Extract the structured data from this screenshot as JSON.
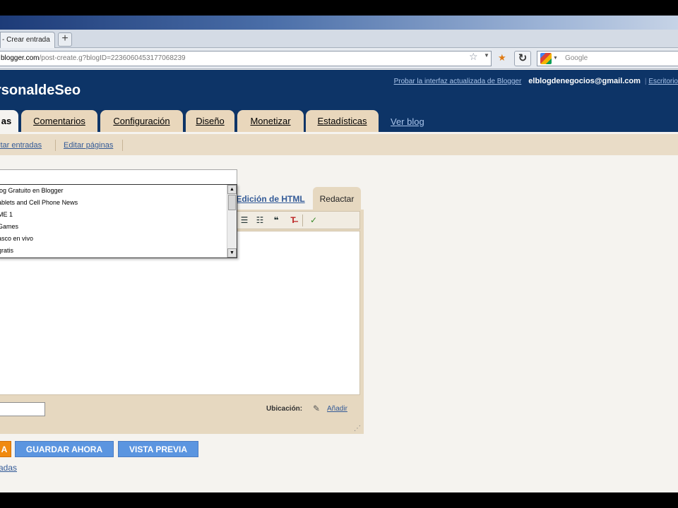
{
  "browser": {
    "tab_title": "- Crear entrada",
    "new_tab": "+",
    "url_domain": "blogger.com",
    "url_path": "/post-create.g?blogID=2236060453177068239",
    "search_placeholder": "Google"
  },
  "header": {
    "blog_name": "rsonaldeSeo",
    "try_link": "Probar la interfaz actualizada de Blogger",
    "email": "elblogdenegocios@gmail.com",
    "desktop_link": "Escritorio",
    "separator": "|"
  },
  "tabs": [
    {
      "label": "as"
    },
    {
      "label": "Comentarios"
    },
    {
      "label": "Configuración"
    },
    {
      "label": "Diseño"
    },
    {
      "label": "Monetizar"
    },
    {
      "label": "Estadísticas"
    }
  ],
  "view_blog": "Ver blog",
  "subtabs": [
    {
      "label": "itar entradas"
    },
    {
      "label": "Editar páginas"
    }
  ],
  "dropdown_items": [
    "log Gratuito en Blogger",
    "ablets and Cell Phone News",
    "ME 1",
    "Games",
    "asco en vivo",
    "gratis"
  ],
  "editor": {
    "html_tab": "Edición de HTML",
    "compose_tab": "Redactar",
    "location_label": "Ubicación:",
    "add_link": "Añadir"
  },
  "actions": {
    "publish": "A",
    "save": "GUARDAR AHORA",
    "preview": "VISTA PREVIA",
    "bottom_link": "adas"
  }
}
